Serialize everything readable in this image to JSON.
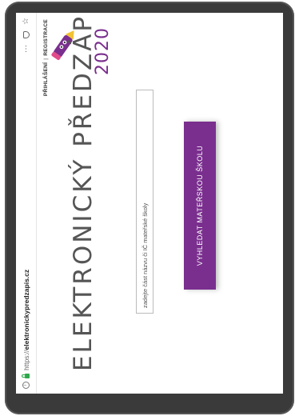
{
  "browser": {
    "url_prefix": "https://",
    "url_domain": "elektronickypredzapis.cz",
    "menu_label": "···"
  },
  "nav": {
    "login": "PŘIHLÁŠENÍ",
    "separator": "|",
    "register": "REGISTRACE"
  },
  "hero": {
    "title": "ELEKTRONICKÝ PŘEDZÁPIS",
    "year": "2020"
  },
  "search": {
    "placeholder": "zadejte část názvu či IČ mateřské školy"
  },
  "action": {
    "button_label": "VYHLEDAT MATEŘSKOU ŠKOLU"
  },
  "colors": {
    "accent": "#7a2f8e",
    "title_gray": "#555555",
    "frame": "#3a3a3a"
  }
}
